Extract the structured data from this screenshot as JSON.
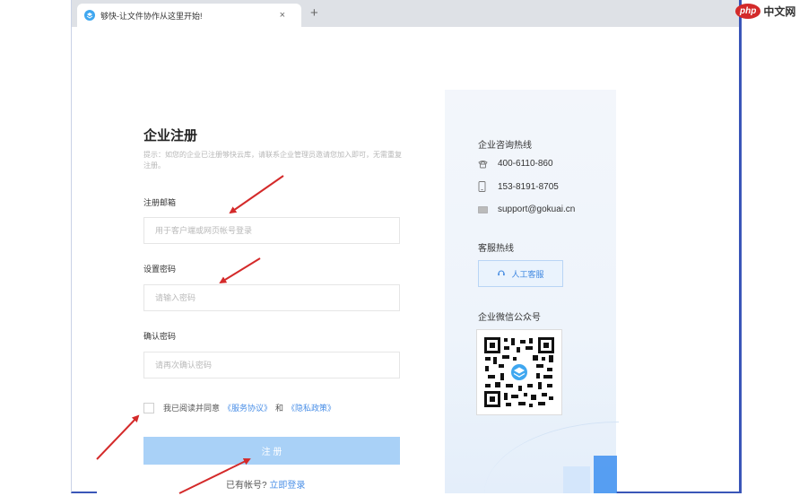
{
  "browser": {
    "tab_title": "够快-让文件协作从这里开始!",
    "tab_close": "×",
    "new_tab": "+"
  },
  "form": {
    "title": "企业注册",
    "hint": "提示：如您的企业已注册够快云库，请联系企业管理员邀请您加入即可，无需重复注册。",
    "email_label": "注册邮箱",
    "email_placeholder": "用于客户端或网页帐号登录",
    "password_label": "设置密码",
    "password_placeholder": "请输入密码",
    "confirm_label": "确认密码",
    "confirm_placeholder": "请再次确认密码",
    "agree_text": "我已阅读并同意",
    "service_link": "《服务协议》",
    "and_text": "和",
    "privacy_link": "《隐私政策》",
    "submit_label": "注 册",
    "have_account": "已有帐号?",
    "login_link": "立即登录"
  },
  "side": {
    "hotline_heading": "企业咨询热线",
    "phone": "400-6110-860",
    "mobile": "153-8191-8705",
    "email": "support@gokuai.cn",
    "service_heading": "客服热线",
    "service_button": "人工客服",
    "wechat_heading": "企业微信公众号"
  },
  "watermark": {
    "logo_text": "php",
    "site_name": "中文网"
  },
  "colors": {
    "accent": "#3c86e0",
    "submit_bg": "#a9d1f7",
    "arrow": "#d42a2a",
    "frame": "#3a56b8"
  },
  "icons": {
    "phone": "phone-icon",
    "mobile": "mobile-icon",
    "email": "mail-icon",
    "service": "headset-icon",
    "qr": "qr-code-icon"
  }
}
